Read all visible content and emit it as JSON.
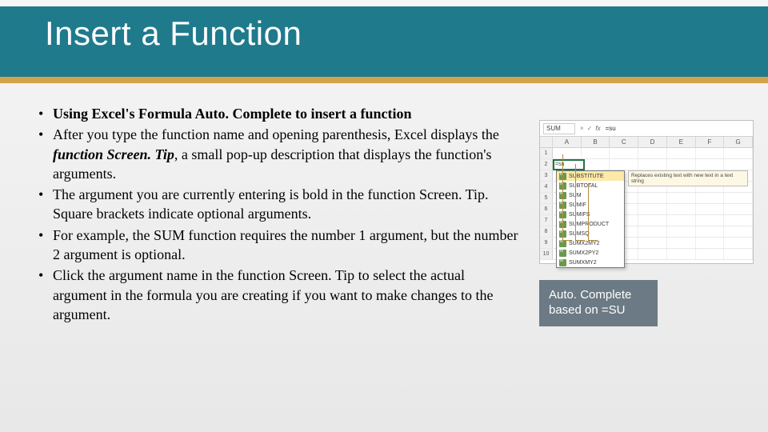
{
  "title": "Insert a Function",
  "bullets": [
    {
      "lead": "Using Excel's Formula Auto. Complete to insert a function",
      "rest": ""
    },
    {
      "lead": "",
      "rest_pre": "After you type the function name and opening parenthesis, Excel displays the ",
      "emph": "function Screen. Tip",
      "rest_post": ", a small pop-up description that displays the function's arguments."
    },
    {
      "lead": "",
      "rest": "The argument you are currently entering is bold in the function Screen. Tip. Square brackets indicate optional arguments."
    },
    {
      "lead": "",
      "rest": "For example, the SUM function requires the number 1 argument, but the number 2 argument is optional."
    },
    {
      "lead": "",
      "rest": " Click the argument name in the function Screen. Tip to select the actual argument in the formula you are creating if you want to make changes to the argument."
    }
  ],
  "excel": {
    "namebox": "SUM",
    "formula": "=su",
    "cell_text": "=su",
    "columns": [
      "",
      "A",
      "B",
      "C",
      "D",
      "E",
      "F",
      "G"
    ],
    "rows": [
      "1",
      "2",
      "3",
      "4",
      "5",
      "6",
      "7",
      "8",
      "9",
      "10"
    ],
    "dropdown": [
      "SUBSTITUTE",
      "SUBTOTAL",
      "SUM",
      "SUMIF",
      "SUMIFS",
      "SUMPRODUCT",
      "SUMSQ",
      "SUMX2MY2",
      "SUMX2PY2",
      "SUMXMY2"
    ],
    "tooltip": "Replaces existing text with new text in a text string"
  },
  "caption": "Auto. Complete based on =SU"
}
